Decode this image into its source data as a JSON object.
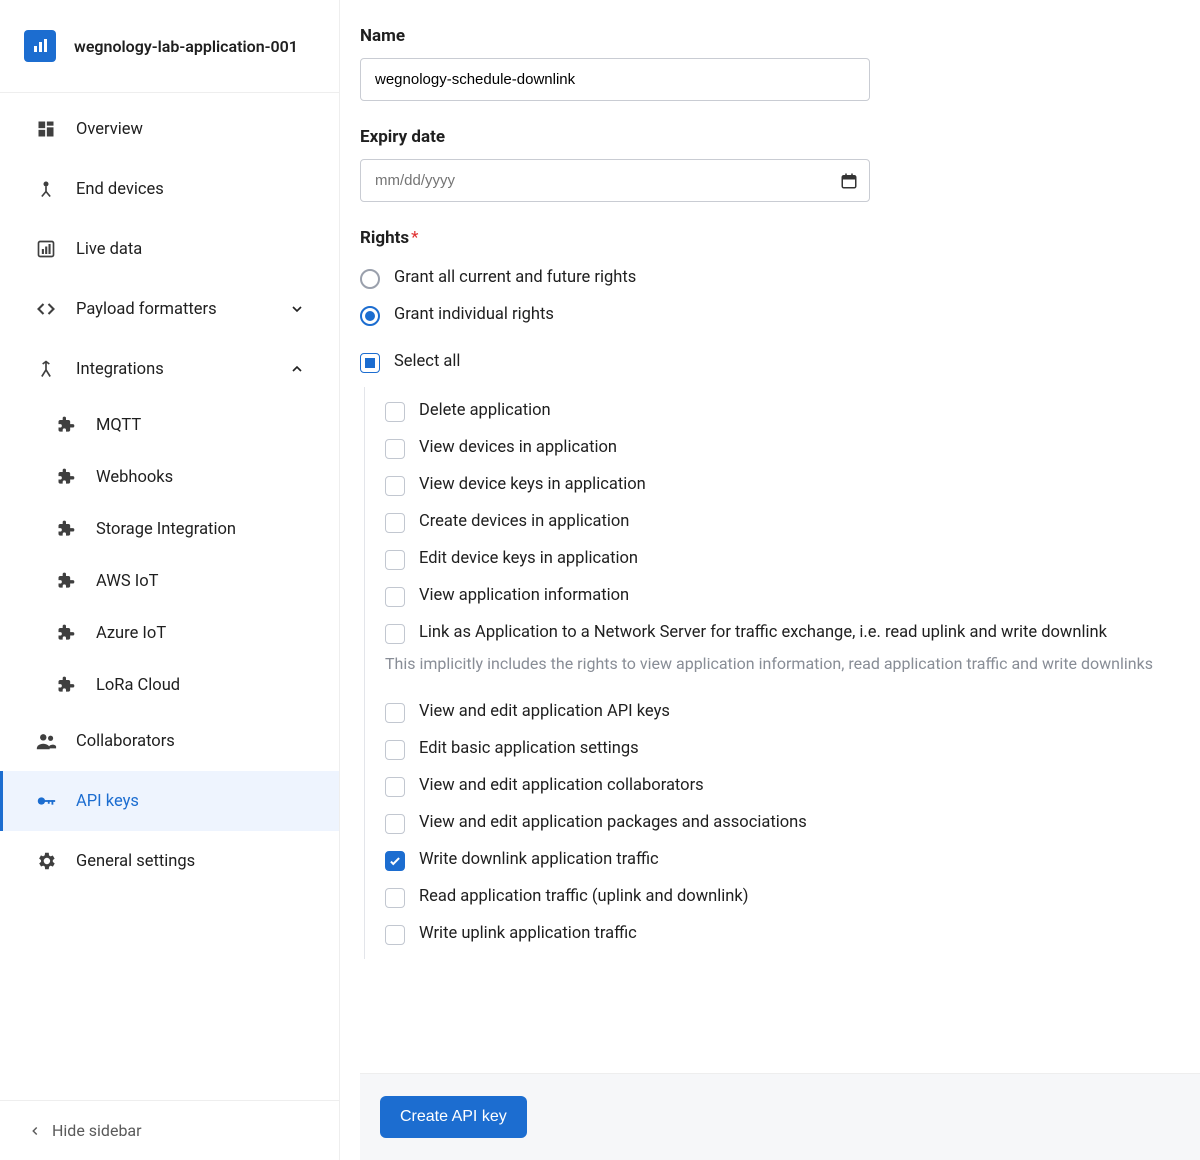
{
  "header": {
    "app_name": "wegnology-lab-application-001"
  },
  "sidebar": {
    "items": [
      {
        "icon": "dashboard-icon",
        "label": "Overview"
      },
      {
        "icon": "device-icon",
        "label": "End devices"
      },
      {
        "icon": "chart-icon",
        "label": "Live data"
      },
      {
        "icon": "code-icon",
        "label": "Payload formatters",
        "expandable": true,
        "expanded": false
      },
      {
        "icon": "merge-icon",
        "label": "Integrations",
        "expandable": true,
        "expanded": true
      },
      {
        "icon": "people-icon",
        "label": "Collaborators"
      },
      {
        "icon": "key-icon",
        "label": "API keys",
        "active": true
      },
      {
        "icon": "gear-icon",
        "label": "General settings"
      }
    ],
    "integrations": [
      {
        "icon": "plugin-icon",
        "label": "MQTT"
      },
      {
        "icon": "plugin-icon",
        "label": "Webhooks"
      },
      {
        "icon": "plugin-icon",
        "label": "Storage Integration"
      },
      {
        "icon": "plugin-icon",
        "label": "AWS IoT"
      },
      {
        "icon": "plugin-icon",
        "label": "Azure IoT"
      },
      {
        "icon": "plugin-icon",
        "label": "LoRa Cloud"
      }
    ],
    "footer": "Hide sidebar"
  },
  "form": {
    "name_label": "Name",
    "name_value": "wegnology-schedule-downlink",
    "expiry_label": "Expiry date",
    "expiry_placeholder": "mm/dd/yyyy",
    "rights_label": "Rights",
    "rights_options": {
      "all": "Grant all current and future rights",
      "individual": "Grant individual rights",
      "selected": "individual"
    },
    "select_all_label": "Select all",
    "select_all_state": "indeterminate",
    "rights_list": [
      {
        "label": "Delete application",
        "checked": false
      },
      {
        "label": "View devices in application",
        "checked": false
      },
      {
        "label": "View device keys in application",
        "checked": false
      },
      {
        "label": "Create devices in application",
        "checked": false
      },
      {
        "label": "Edit device keys in application",
        "checked": false
      },
      {
        "label": "View application information",
        "checked": false
      },
      {
        "label": "Link as Application to a Network Server for traffic exchange, i.e. read uplink and write downlink",
        "checked": false,
        "helper": "This implicitly includes the rights to view application information, read application traffic and write downlinks"
      },
      {
        "label": "View and edit application API keys",
        "checked": false
      },
      {
        "label": "Edit basic application settings",
        "checked": false
      },
      {
        "label": "View and edit application collaborators",
        "checked": false
      },
      {
        "label": "View and edit application packages and associations",
        "checked": false
      },
      {
        "label": "Write downlink application traffic",
        "checked": true
      },
      {
        "label": "Read application traffic (uplink and downlink)",
        "checked": false
      },
      {
        "label": "Write uplink application traffic",
        "checked": false
      }
    ],
    "submit_label": "Create API key"
  }
}
